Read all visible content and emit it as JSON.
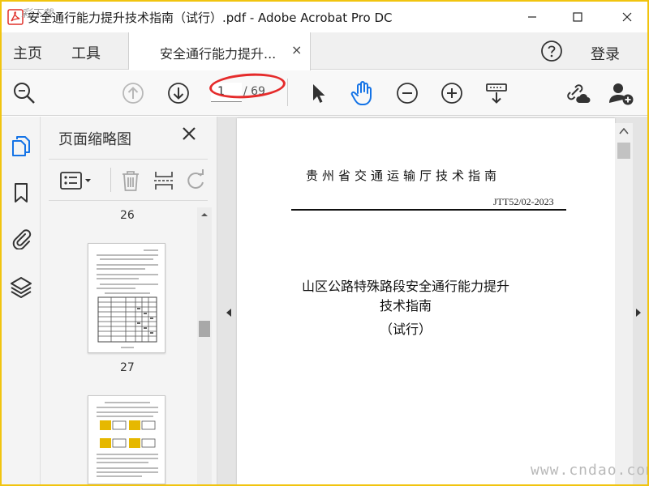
{
  "window": {
    "title": "安全通行能力提升技术指南（试行）.pdf - Adobe Acrobat Pro DC",
    "watermark_corner": "彩下载"
  },
  "menu": {
    "home": "主页",
    "tools": "工具",
    "login": "登录"
  },
  "doc_tab": {
    "label": "安全通行能力提升...",
    "close": "×"
  },
  "toolbar": {
    "current_page": "1",
    "page_total": "/ 69"
  },
  "thumbnails": {
    "title": "页面缩略图",
    "pages": [
      {
        "number": "26"
      },
      {
        "number": "27"
      }
    ]
  },
  "document": {
    "org_title": "贵州省交通运输厅技术指南",
    "code": "JTT52/02-2023",
    "heading_line1": "山区公路特殊路段安全通行能力提升",
    "heading_line2": "技术指南",
    "heading_line3": "（试行）"
  },
  "site_watermark": "www.cndao.com",
  "colors": {
    "frame": "#f1c40f",
    "accent_blue": "#1473e6",
    "annotation_red": "#e52b2b"
  }
}
